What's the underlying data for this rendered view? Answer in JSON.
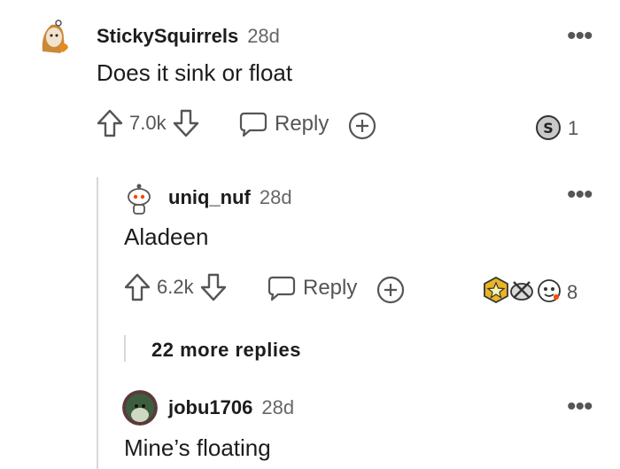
{
  "comments": [
    {
      "username": "StickySquirrels",
      "age": "28d",
      "body": "Does it sink or float",
      "score": "7.0k",
      "reply_label": "Reply",
      "award_count": "1"
    },
    {
      "username": "uniq_nuf",
      "age": "28d",
      "body": "Aladeen",
      "score": "6.2k",
      "reply_label": "Reply",
      "award_count": "8"
    },
    {
      "username": "jobu1706",
      "age": "28d",
      "body": "Mine’s floating"
    }
  ],
  "more_replies": "22 more replies",
  "more_menu": "•••",
  "colors": {
    "text": "#1c1c1c",
    "muted": "#555555",
    "thread": "#d7d7d7"
  }
}
